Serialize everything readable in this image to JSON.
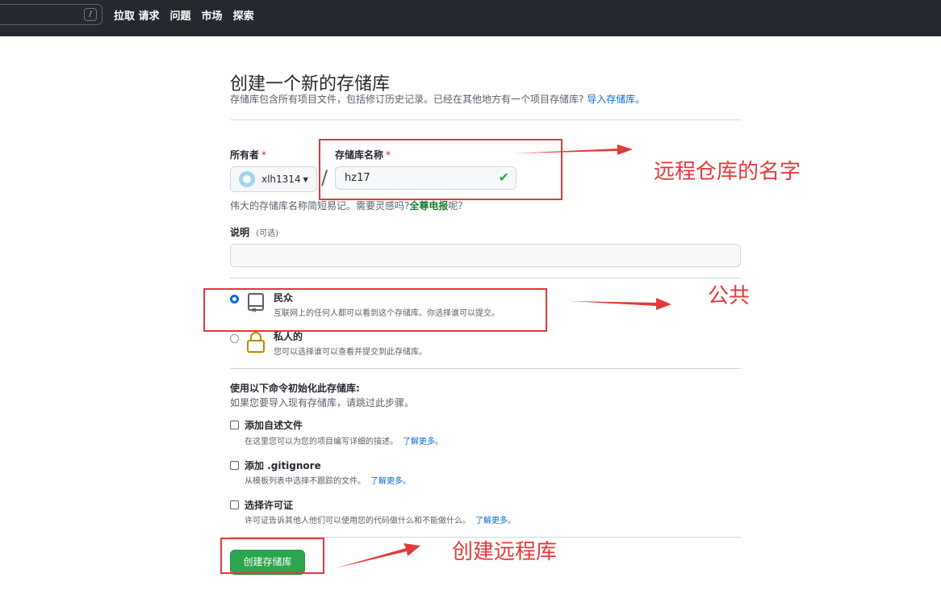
{
  "header": {
    "search_key": "/",
    "nav": [
      "拉取 请求",
      "问题",
      "市场",
      "探索"
    ]
  },
  "page": {
    "title": "创建一个新的存储库",
    "subtitle": "存储库包含所有项目文件，包括修订历史记录。已经在其他地方有一个项目存储库?",
    "import_link": "导入存储库。"
  },
  "form": {
    "owner_label": "所有者",
    "owner_value": "xlh1314",
    "repo_name_label": "存储库名称",
    "required_mark": "*",
    "separator": "/",
    "repo_name_value": "hz17",
    "hint_prefix": "伟大的存储库名称简短易记。需要灵感吗?",
    "hint_suggestion": "全尊电报",
    "hint_suffix": "呢？",
    "desc_label": "说明",
    "desc_optional": "(可选)"
  },
  "visibility": {
    "public_title": "民众",
    "public_desc": "互联网上的任何人都可以看到这个存储库。你选择谁可以提交。",
    "private_title": "私人的",
    "private_desc": "您可以选择谁可以查看并提交到此存储库。",
    "selected": "public"
  },
  "init": {
    "title": "使用以下命令初始化此存储库:",
    "subtitle": "如果您要导入现有存储库，请跳过此步骤。",
    "options": [
      {
        "title": "添加自述文件",
        "desc": "在这里您可以为您的项目编写详细的描述。",
        "link": "了解更多。"
      },
      {
        "title": "添加 .gitignore",
        "desc": "从模板列表中选择不跟踪的文件。",
        "link": "了解更多。"
      },
      {
        "title": "选择许可证",
        "desc": "许可证告诉其他人他们可以使用您的代码做什么和不能做什么。",
        "link": "了解更多。"
      }
    ]
  },
  "create_button": "创建存储库",
  "annotations": {
    "repo_name_note": "远程仓库的名字",
    "public_note": "公共",
    "create_note": "创建远程库",
    "color": "#e23a3a"
  }
}
